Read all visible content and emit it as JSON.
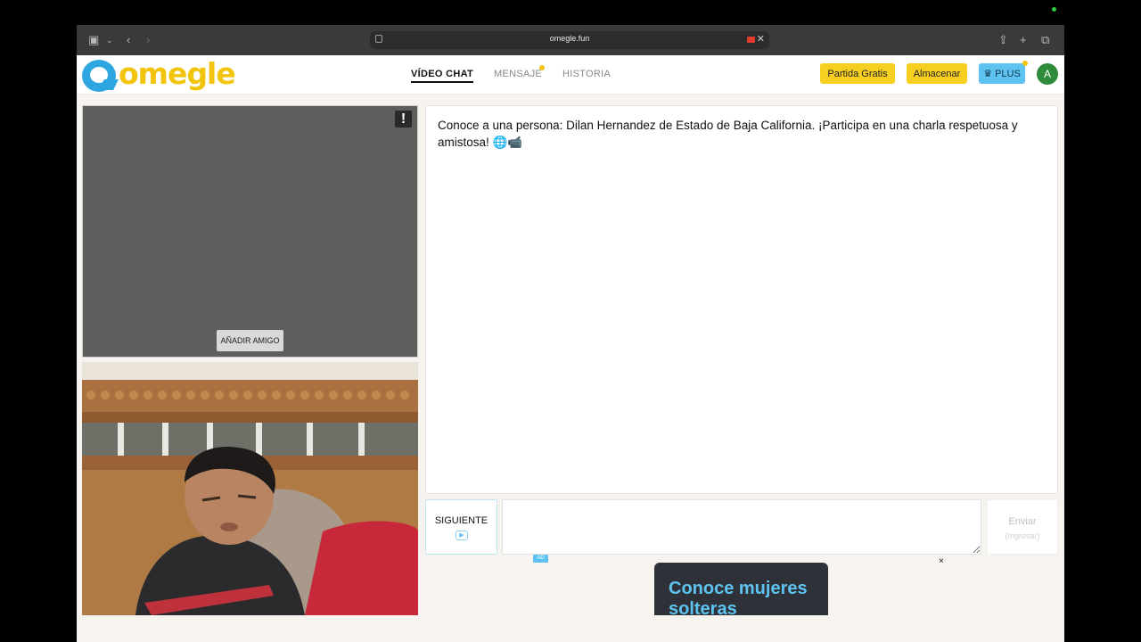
{
  "browser": {
    "url": "omegle.fun"
  },
  "header": {
    "logo_text": "omegle",
    "nav": [
      {
        "label": "VÍDEO CHAT",
        "active": true
      },
      {
        "label": "MENSAJE",
        "active": false
      },
      {
        "label": "HISTORIA",
        "active": false
      }
    ],
    "btn_free_match": "Partida Gratis",
    "btn_store": "Almacenar",
    "btn_plus": "PLUS",
    "avatar_letter": "A"
  },
  "video": {
    "report_label": "!",
    "add_friend_label": "AÑADIR AMIGO"
  },
  "chat": {
    "message": "Conoce a una persona: Dilan Hernandez de Estado de Baja California. ¡Participa en una charla respetuosa y amistosa! 🌐📹",
    "next_label": "SIGUIENTE",
    "input_value": "",
    "send_label": "Enviar",
    "send_hint": "(Ingresar)"
  },
  "ad": {
    "badge": "AD",
    "close": "×",
    "headline": "Conoce mujeres solteras"
  },
  "colors": {
    "brand_yellow": "#f7cf21",
    "brand_blue": "#5ec3f0",
    "avatar_green": "#2e8b3a"
  }
}
